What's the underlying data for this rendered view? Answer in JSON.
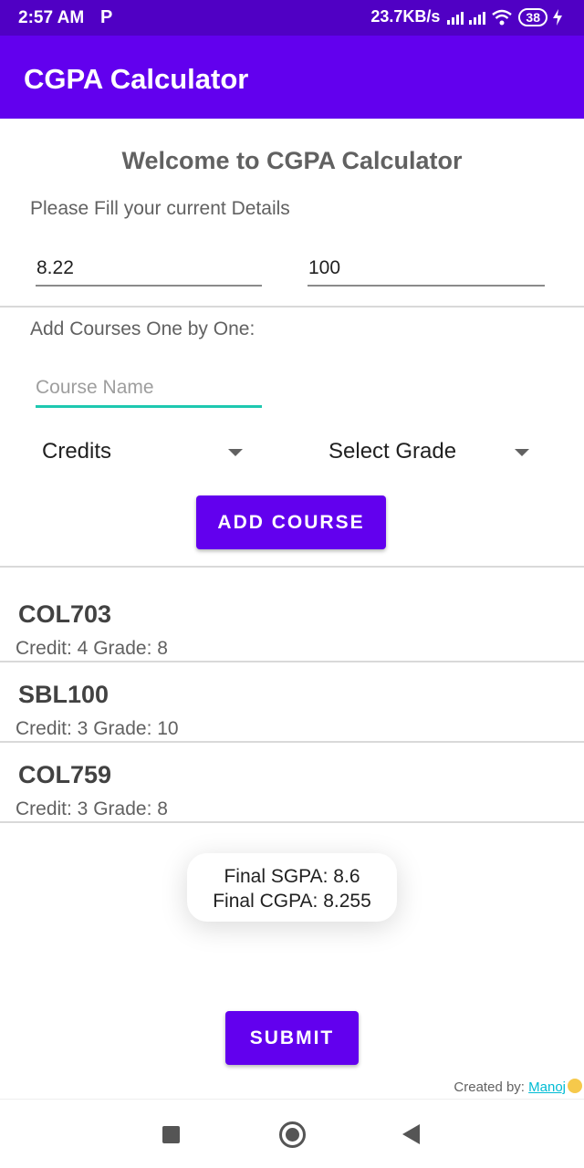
{
  "status_bar": {
    "time": "2:57 AM",
    "notification_icon": "P",
    "network_speed": "23.7KB/s",
    "battery": "38"
  },
  "app_bar": {
    "title": "CGPA Calculator"
  },
  "main": {
    "welcome": "Welcome to CGPA Calculator",
    "fill_label": "Please Fill your current Details",
    "current_cgpa_value": "8.22",
    "current_credits_value": "100",
    "add_courses_label": "Add Courses One by One:",
    "course_name_placeholder": "Course Name",
    "credits_spinner": "Credits",
    "grade_spinner": "Select Grade",
    "add_course_button": "ADD COURSE"
  },
  "courses": [
    {
      "name": "COL703",
      "detail": "Credit: 4 Grade: 8"
    },
    {
      "name": "SBL100",
      "detail": "Credit: 3 Grade: 10"
    },
    {
      "name": "COL759",
      "detail": "Credit: 3 Grade: 8"
    }
  ],
  "toast": {
    "sgpa": "Final SGPA: 8.6",
    "cgpa": "Final CGPA: 8.255"
  },
  "submit_button": "SUBMIT",
  "footer": {
    "created_by": "Created by: ",
    "author": "Manoj"
  },
  "colors": {
    "primary": "#6200ee",
    "status_bar": "#5000c4",
    "accent": "#1ec8b0"
  },
  "icons": [
    "wifi-icon",
    "signal-icon",
    "battery-icon",
    "charging-icon",
    "nav-recents-icon",
    "nav-home-icon",
    "nav-back-icon"
  ]
}
